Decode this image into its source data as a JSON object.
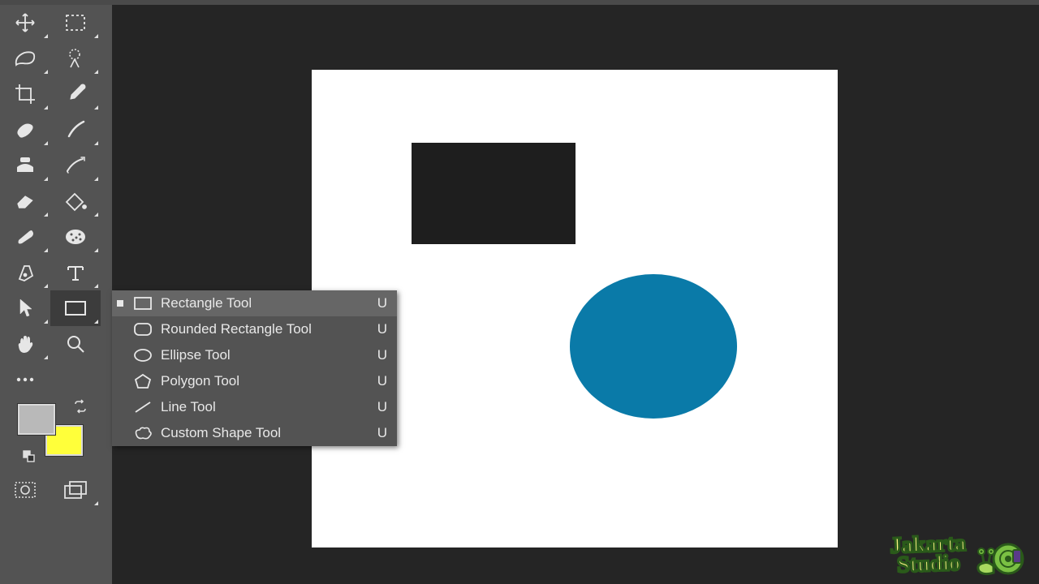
{
  "toolbar": {
    "tools": [
      [
        "move",
        "marquee"
      ],
      [
        "lasso",
        "quick-select"
      ],
      [
        "crop",
        "eyedropper"
      ],
      [
        "healing",
        "brush"
      ],
      [
        "stamp",
        "history-brush"
      ],
      [
        "eraser",
        "paint-bucket"
      ],
      [
        "dodge",
        "sponge"
      ],
      [
        "pen",
        "type"
      ],
      [
        "path-select",
        "rectangle"
      ],
      [
        "hand",
        "zoom"
      ],
      [
        "more",
        ""
      ]
    ],
    "foreground_color": "#b9b9b9",
    "background_color": "#ffff3a"
  },
  "shape_menu": {
    "selected": "rectangle",
    "items": [
      {
        "id": "rectangle",
        "label": "Rectangle Tool",
        "key": "U"
      },
      {
        "id": "rounded-rect",
        "label": "Rounded Rectangle Tool",
        "key": "U"
      },
      {
        "id": "ellipse",
        "label": "Ellipse Tool",
        "key": "U"
      },
      {
        "id": "polygon",
        "label": "Polygon Tool",
        "key": "U"
      },
      {
        "id": "line",
        "label": "Line Tool",
        "key": "U"
      },
      {
        "id": "custom",
        "label": "Custom Shape Tool",
        "key": "U"
      }
    ]
  },
  "canvas": {
    "shapes": {
      "rect_color": "#1e1e1e",
      "ellipse_color": "#0a7aa8"
    }
  },
  "watermark": {
    "line1": "Jakarta",
    "line2": "Studio"
  }
}
